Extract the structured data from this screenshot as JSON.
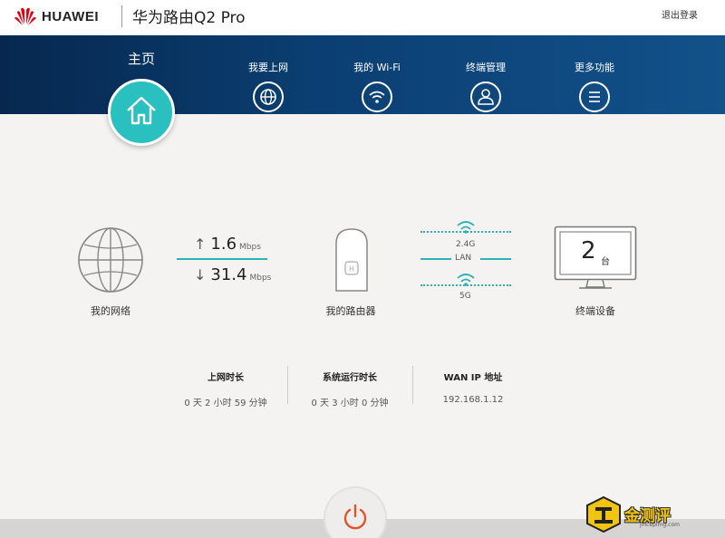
{
  "header": {
    "brand": "HUAWEI",
    "product": "华为路由Q2 Pro",
    "logout": "退出登录"
  },
  "nav": {
    "home": "主页",
    "items": [
      {
        "label": "我要上网",
        "icon": "globe-icon"
      },
      {
        "label": "我的 Wi-Fi",
        "icon": "wifi-icon"
      },
      {
        "label": "终端管理",
        "icon": "user-icon"
      },
      {
        "label": "更多功能",
        "icon": "menu-icon"
      }
    ]
  },
  "status": {
    "network_label": "我的网络",
    "upload_arrow": "↑",
    "upload_value": "1.6",
    "upload_unit": "Mbps",
    "download_arrow": "↓",
    "download_value": "31.4",
    "download_unit": "Mbps",
    "router_label": "我的路由器",
    "band_24": "2.4G",
    "lan": "LAN",
    "band_5": "5G",
    "device_count": "2",
    "device_unit": "台",
    "device_label": "终端设备"
  },
  "info": {
    "online_title": "上网时长",
    "online_value": "0 天 2 小时 59 分钟",
    "uptime_title": "系统运行时长",
    "uptime_value": "0 天 3 小时 0 分钟",
    "wan_title": "WAN IP 地址",
    "wan_value": "192.168.1.12"
  },
  "watermark": {
    "text": "金测评",
    "sub": "jincepimg.com"
  },
  "colors": {
    "accent": "#29c0bf",
    "nav_dark": "#06284f",
    "power": "#e0542c",
    "line": "#2bb3b5"
  }
}
